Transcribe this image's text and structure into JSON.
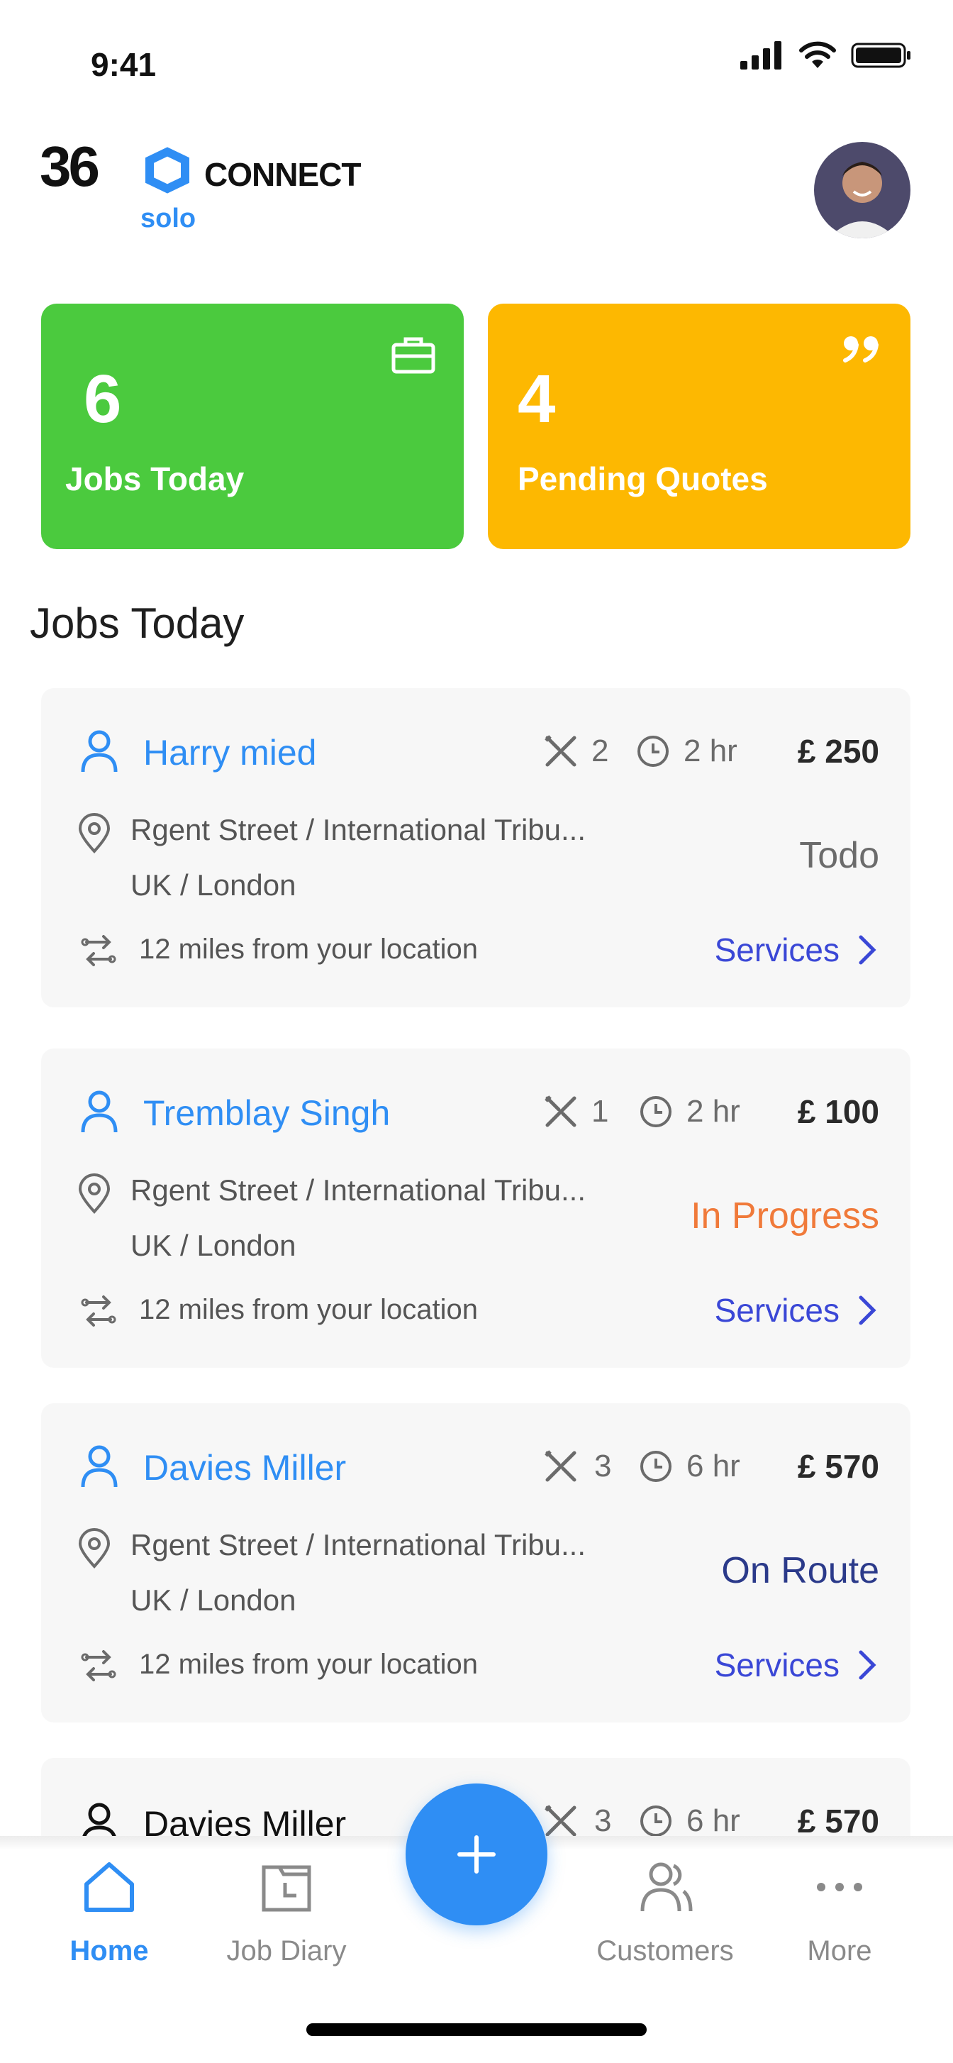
{
  "status_bar": {
    "time": "9:41"
  },
  "header": {
    "logo_text": "360 CONNECT",
    "logo_subtext": "solo",
    "colors": {
      "logo_dark": "#111111",
      "logo_accent": "#2f8ef4"
    }
  },
  "stats": [
    {
      "value": "6",
      "label": "Jobs Today",
      "icon": "briefcase-icon",
      "color": "#4bca3e"
    },
    {
      "value": "4",
      "label": "Pending Quotes",
      "icon": "quote-icon",
      "color": "#fdb801"
    }
  ],
  "section_title": "Jobs Today",
  "jobs": [
    {
      "customer": "Harry mied",
      "tools": "2",
      "duration": "2 hr",
      "price": "£ 250",
      "address_line1": "Rgent Street / International Tribu...",
      "address_line2": "UK / London",
      "status": "Todo",
      "status_color": "#6b6b6b",
      "distance": "12 miles from your location",
      "link": "Services"
    },
    {
      "customer": "Tremblay Singh",
      "tools": "1",
      "duration": "2 hr",
      "price": "£ 100",
      "address_line1": "Rgent Street / International Tribu...",
      "address_line2": "UK / London",
      "status": "In Progress",
      "status_color": "#f07a3a",
      "distance": "12 miles from your location",
      "link": "Services"
    },
    {
      "customer": "Davies Miller",
      "tools": "3",
      "duration": "6 hr",
      "price": "£ 570",
      "address_line1": "Rgent Street / International Tribu...",
      "address_line2": "UK / London",
      "status": "On Route",
      "status_color": "#2b3a8a",
      "distance": "12 miles from your location",
      "link": "Services"
    },
    {
      "customer": "Davies Miller",
      "tools": "3",
      "duration": "6 hr",
      "price": "£ 570"
    }
  ],
  "bottom_nav": {
    "items": [
      {
        "label": "Home",
        "icon": "home-icon",
        "active": true
      },
      {
        "label": "Job Diary",
        "icon": "calendar-icon",
        "active": false
      },
      {
        "label": "Customers",
        "icon": "customers-icon",
        "active": false
      },
      {
        "label": "More",
        "icon": "more-icon",
        "active": false
      }
    ],
    "fab_icon": "plus-icon",
    "accent": "#2f8ef4"
  }
}
